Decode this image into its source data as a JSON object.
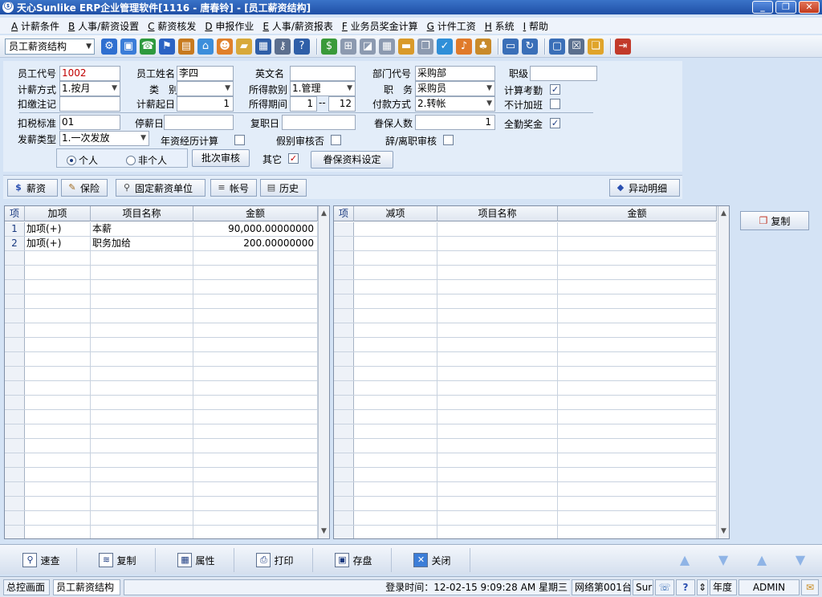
{
  "window": {
    "title": "天心Sunlike ERP企业管理软件[1116 - 唐春铃] - [员工薪资结构]",
    "app_icon": "ⓢ",
    "min_glyph": "_",
    "max_glyph": "❐",
    "close_glyph": "✕"
  },
  "menu": [
    {
      "key": "A",
      "label": " 计薪条件"
    },
    {
      "key": "B",
      "label": " 人事/薪资设置"
    },
    {
      "key": "C",
      "label": " 薪资核发"
    },
    {
      "key": "D",
      "label": " 申报作业"
    },
    {
      "key": "E",
      "label": " 人事/薪资报表"
    },
    {
      "key": "F",
      "label": " 业务员奖金计算"
    },
    {
      "key": "G",
      "label": " 计件工资"
    },
    {
      "key": "H",
      "label": " 系统"
    },
    {
      "key": "I",
      "label": " 帮助"
    }
  ],
  "toolbar": {
    "module_select": "员工薪资结构",
    "arrow": "▼",
    "icons": [
      {
        "name": "tree-icon",
        "glyph": "⚙",
        "color": "#2f6fd0"
      },
      {
        "name": "monitor-icon",
        "glyph": "▣",
        "color": "#3b7dd8"
      },
      {
        "name": "phone-icon",
        "glyph": "☎",
        "color": "#2e9a3e"
      },
      {
        "name": "org-icon",
        "glyph": "⚑",
        "color": "#2b63c4"
      },
      {
        "name": "briefcase-icon",
        "glyph": "▤",
        "color": "#c77a1e"
      },
      {
        "name": "home-icon",
        "glyph": "⌂",
        "color": "#3c8edb"
      },
      {
        "name": "users-icon",
        "glyph": "☻",
        "color": "#e0802a"
      },
      {
        "name": "folder-icon",
        "glyph": "▰",
        "color": "#d8a93a"
      },
      {
        "name": "document-icon",
        "glyph": "▦",
        "color": "#2f5fa8"
      },
      {
        "name": "key-icon",
        "glyph": "⚷",
        "color": "#5c6f8e"
      },
      {
        "name": "help-icon",
        "glyph": "?",
        "color": "#2f5fa8"
      },
      {
        "name": "money-icon",
        "glyph": "$",
        "color": "#3a9a3a"
      },
      {
        "name": "cart-icon",
        "glyph": "⊞",
        "color": "#8c9ab0"
      },
      {
        "name": "chart-icon",
        "glyph": "◪",
        "color": "#8c9ab0"
      },
      {
        "name": "calculator-icon",
        "glyph": "▦",
        "color": "#8c9ab0"
      },
      {
        "name": "database-icon",
        "glyph": "▬",
        "color": "#d99a2a"
      },
      {
        "name": "copy-icon",
        "glyph": "❐",
        "color": "#8c9ab0"
      },
      {
        "name": "check-icon",
        "glyph": "✓",
        "color": "#2f8fd8"
      },
      {
        "name": "bell-icon",
        "glyph": "♪",
        "color": "#e07a2a"
      },
      {
        "name": "people-icon",
        "glyph": "♣",
        "color": "#c98a2a"
      },
      {
        "name": "screen-icon",
        "glyph": "▭",
        "color": "#3a6fb8"
      },
      {
        "name": "refresh-icon",
        "glyph": "↻",
        "color": "#3a6fb8"
      },
      {
        "name": "window-icon",
        "glyph": "▢",
        "color": "#3a6fb8"
      },
      {
        "name": "close-window-icon",
        "glyph": "☒",
        "color": "#5a6f8e"
      },
      {
        "name": "cascade-icon",
        "glyph": "❏",
        "color": "#e0a42a"
      },
      {
        "name": "exit-icon",
        "glyph": "⇥",
        "color": "#c23a2a"
      }
    ]
  },
  "form": {
    "emp_code_label": "员工代号",
    "emp_code": "1002",
    "emp_name_label": "员工姓名",
    "emp_name": "李四",
    "eng_name_label": "英文名",
    "eng_name": "",
    "dept_code_label": "部门代号",
    "dept_code": "采购部",
    "grade_label": "职级",
    "grade": "",
    "calc_method_label": "计薪方式",
    "calc_method": "1.按月",
    "category_label": "类　别",
    "category": "",
    "income_type_label": "所得款别",
    "income_type": "1.管理",
    "position_label": "职　务",
    "position": "采购员",
    "attendance_label": "计算考勤",
    "attendance_checked": "✓",
    "deduct_note_label": "扣缴注记",
    "deduct_note": "",
    "start_day_label": "计薪起日",
    "start_day": "1",
    "income_period_label": "所得期间",
    "period_from": "1",
    "period_sep": "--",
    "period_to": "12",
    "payment_label": "付款方式",
    "payment": "2.转帐",
    "no_overtime_label": "不计加班",
    "no_overtime_checked": "",
    "tax_std_label": "扣税标准",
    "tax_std": "01",
    "stop_day_label": "停薪日",
    "stop_day": "",
    "rejoin_day_label": "复职日",
    "rejoin_day": "",
    "dependents_label": "眷保人数",
    "dependents": "1",
    "full_attendance_label": "全勤奖金",
    "full_attendance_checked": "✓",
    "pay_type_label": "发薪类型",
    "pay_type": "1.一次发放",
    "seniority_label": "年资经历计算",
    "seniority_checked": "",
    "leave_audit_label": "假别审核否",
    "leave_audit_checked": "",
    "resign_audit_label": "辞/离职审核",
    "resign_audit_checked": "",
    "personal_label": "个人",
    "non_personal_label": "非个人",
    "batch_audit_label": "批次审核",
    "other_label": "其它",
    "other_checked": "✓",
    "dependent_setup_label": "眷保资料设定",
    "dd": "▼"
  },
  "tabs": [
    {
      "label": "薪资",
      "icon": "$"
    },
    {
      "label": "保险",
      "icon": "✎"
    },
    {
      "label": "固定薪资单位",
      "icon": "⚲"
    },
    {
      "label": "帐号",
      "icon": "≡"
    },
    {
      "label": "历史",
      "icon": "▤"
    }
  ],
  "change_detail_label": "异动明细",
  "change_detail_icon": "◆",
  "left_grid": {
    "headers": [
      "项",
      "加项",
      "项目名称",
      "金额"
    ],
    "rows": [
      {
        "idx": "1",
        "type": "加项(+)",
        "name": "本薪",
        "amount": "90,000.00000000"
      },
      {
        "idx": "2",
        "type": "加项(+)",
        "name": "职务加给",
        "amount": "200.00000000"
      }
    ]
  },
  "right_grid": {
    "headers": [
      "项",
      "减项",
      "项目名称",
      "金额"
    ],
    "rows": []
  },
  "scroll_up": "▲",
  "scroll_down": "▼",
  "copy_button": {
    "label": "复制",
    "icon": "❐"
  },
  "actions": [
    {
      "label": "速查",
      "icon": "⚲"
    },
    {
      "label": "复制",
      "icon": "≋"
    },
    {
      "label": "属性",
      "icon": "▦"
    },
    {
      "label": "打印",
      "icon": "⎙"
    },
    {
      "label": "存盘",
      "icon": "▣"
    },
    {
      "label": "关闭",
      "icon": "✕"
    }
  ],
  "nav": {
    "first": "▲",
    "prev": "▼",
    "next": "▲",
    "last": "▼"
  },
  "status": {
    "home": "总控画面",
    "current": "员工薪资结构",
    "login": "登录时间：12-02-15 9:09:28 AM  星期三",
    "network": "网络第001台",
    "short": "Sur",
    "year": "年度",
    "user": "ADMIN",
    "help_glyph": "?",
    "mail_glyph": "✉",
    "net_glyph": "☏",
    "spin_glyph": "⇕"
  }
}
